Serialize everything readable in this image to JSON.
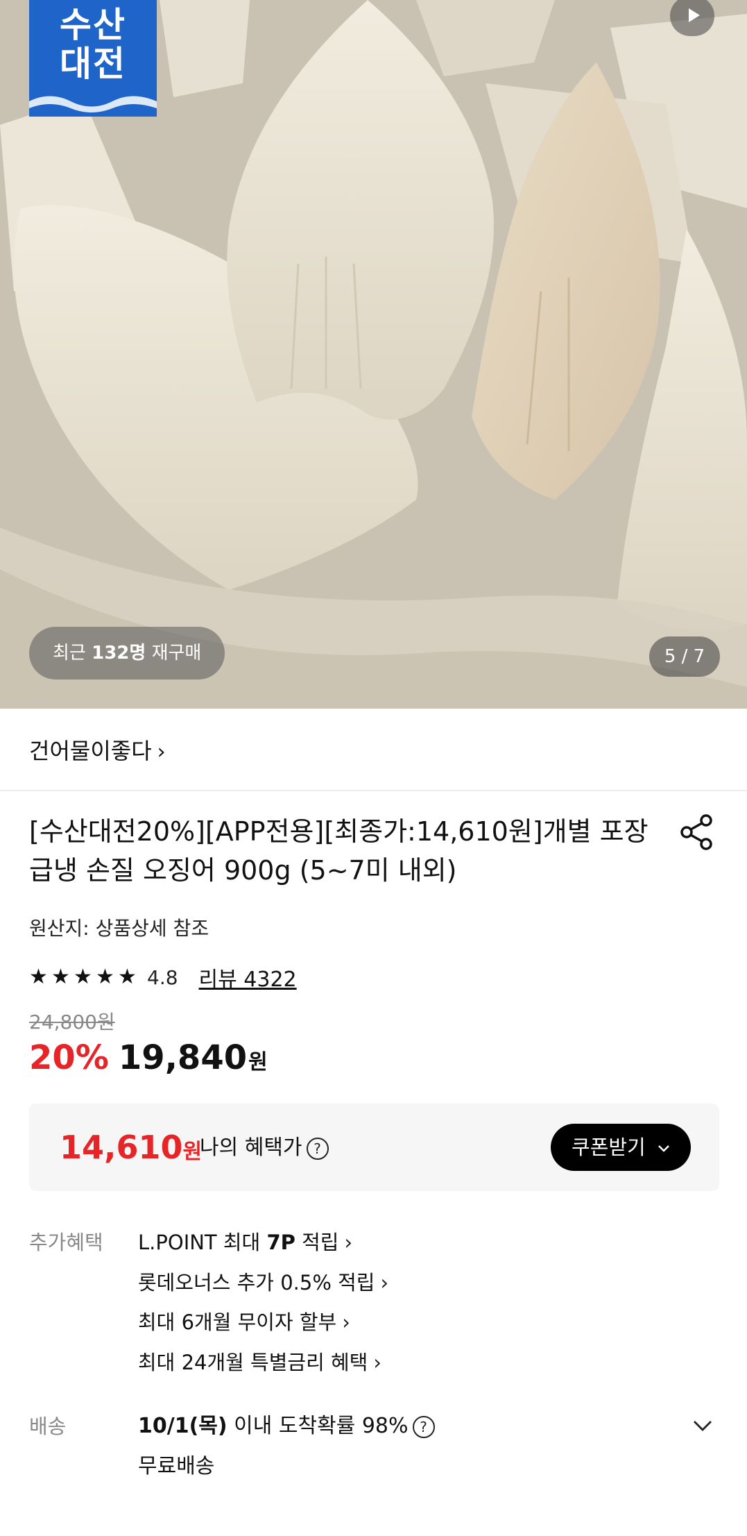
{
  "hero": {
    "brand_badge": {
      "line1": "수산",
      "line2": "대전"
    },
    "rebuy_prefix": "최근 ",
    "rebuy_count": "132명",
    "rebuy_suffix": " 재구매",
    "page_indicator": "5 / 7"
  },
  "store": {
    "name": "건어물이좋다",
    "chevron": "›"
  },
  "product": {
    "title": "[수산대전20%][APP전용][최종가:14,610원]개별 포장 급냉 손질 오징어 900g (5~7미 내외)",
    "origin": "원산지: 상품상세 참조",
    "rating": {
      "stars": 5,
      "value": "4.8",
      "review_label": "리뷰 4322"
    },
    "original_price": "24,800원",
    "discount": "20%",
    "sale_price": "19,840",
    "won": "원"
  },
  "benefit": {
    "price": "14,610",
    "won": "원",
    "label": "나의 혜택가",
    "help": "?",
    "coupon_button": "쿠폰받기"
  },
  "extra": {
    "label": "추가혜택",
    "items": [
      {
        "pre": "L.POINT 최대 ",
        "bold": "7P",
        "post": " 적립"
      },
      {
        "pre": "롯데오너스 추가 0.5% 적립",
        "bold": "",
        "post": ""
      },
      {
        "pre": "최대 6개월 무이자 할부",
        "bold": "",
        "post": ""
      },
      {
        "pre": "최대 24개월 특별금리 혜택",
        "bold": "",
        "post": ""
      }
    ]
  },
  "shipping": {
    "label": "배송",
    "date": "10/1(목)",
    "text": " 이내 도착확률 98%",
    "help": "?",
    "fee": "무료배송"
  },
  "colors": {
    "brand_blue": "#1f64c8",
    "discount_red": "#e52528",
    "coupon_black": "#000000"
  }
}
